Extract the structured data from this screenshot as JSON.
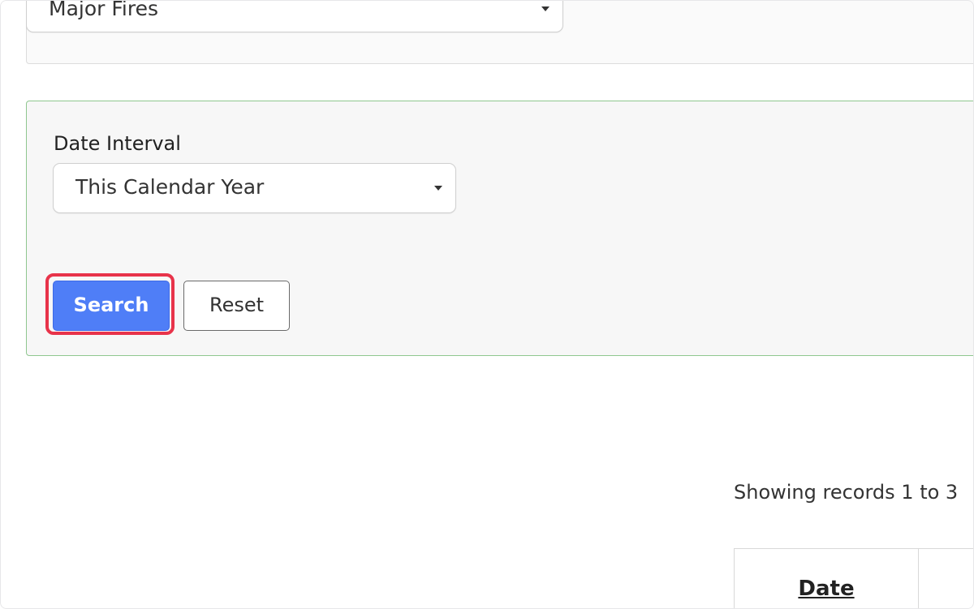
{
  "top_filter": {
    "selected": "Major Fires"
  },
  "date_interval": {
    "label": "Date Interval",
    "selected": "This Calendar Year"
  },
  "buttons": {
    "search": "Search",
    "reset": "Reset"
  },
  "results": {
    "records_info": "Showing records 1 to 3",
    "columns": [
      "Date"
    ]
  },
  "colors": {
    "search_button": "#4f7ef7",
    "highlight": "#e8334a",
    "panel_border": "#8fc78f"
  }
}
